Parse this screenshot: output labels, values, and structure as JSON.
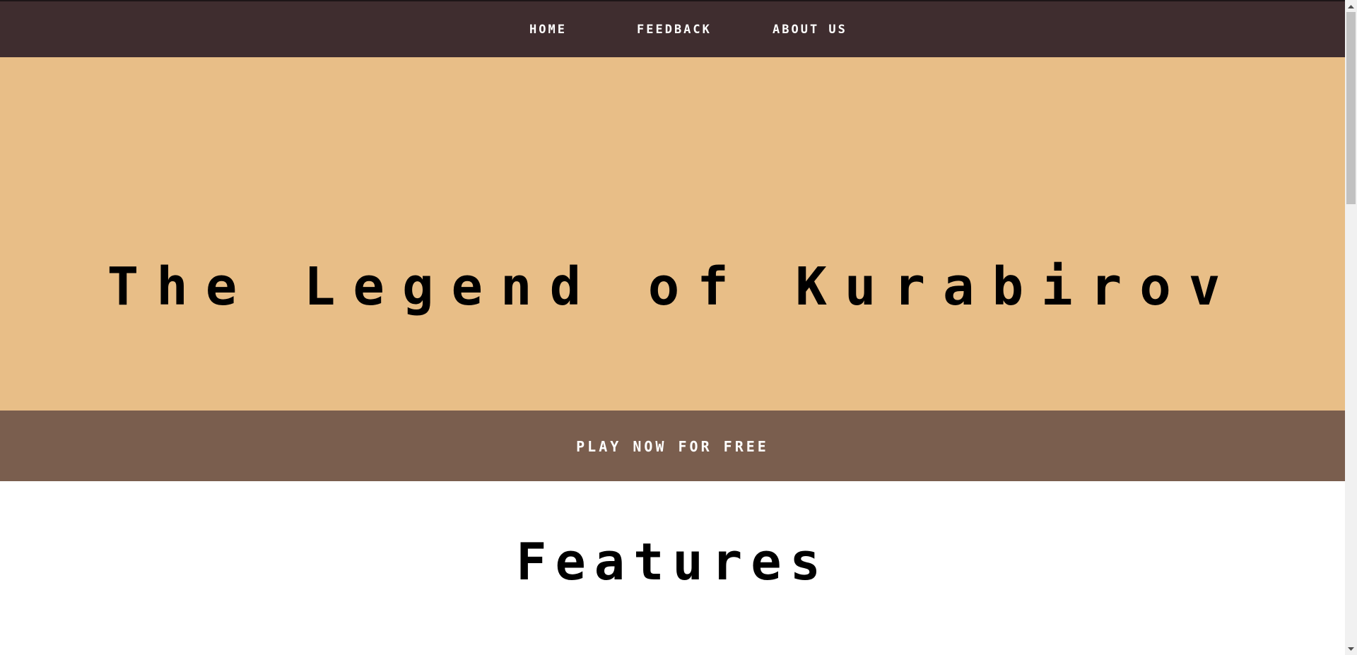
{
  "nav": {
    "items": [
      {
        "label": "HOME"
      },
      {
        "label": "FEEDBACK"
      },
      {
        "label": "ABOUT US"
      }
    ]
  },
  "hero": {
    "title": "The Legend of Kurabirov"
  },
  "cta": {
    "label": "PLAY NOW FOR FREE"
  },
  "features": {
    "heading": "Features"
  },
  "colors": {
    "navbar": "#3f2d2f",
    "hero": "#e8be87",
    "cta": "#7a5e4e",
    "text_light": "#ffffff",
    "text_dark": "#000000"
  },
  "icons": {
    "scroll_up": "chevron-up-icon",
    "scroll_down": "chevron-down-icon"
  }
}
